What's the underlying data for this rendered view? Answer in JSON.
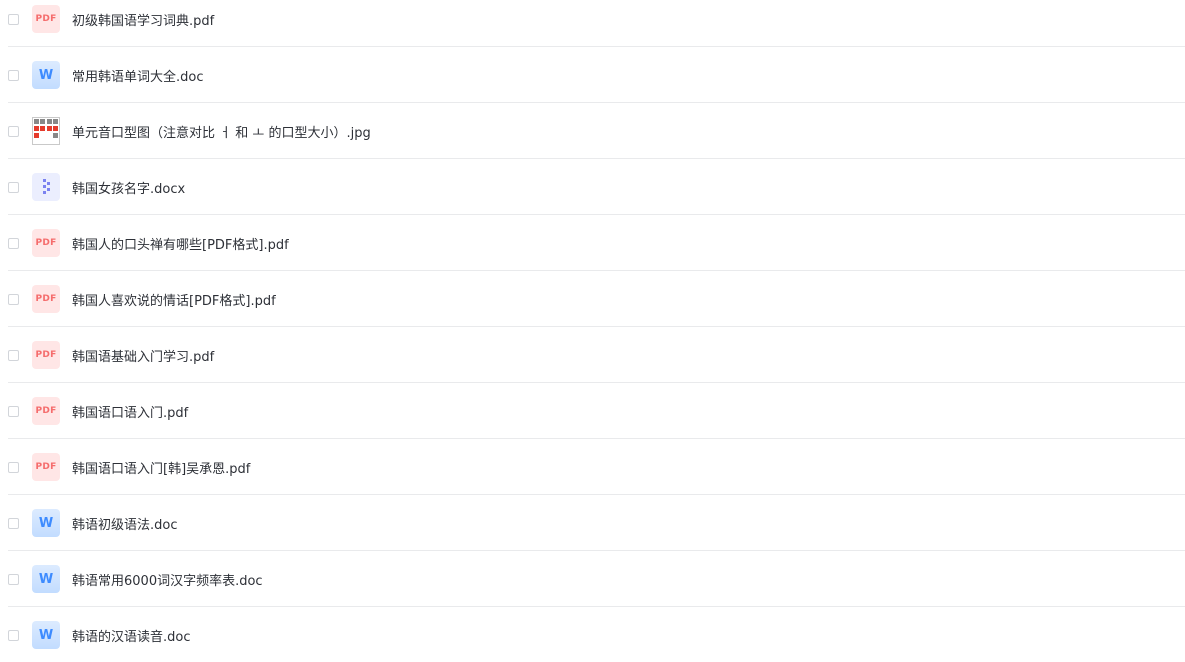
{
  "files": [
    {
      "name": "初级韩国语学习词典.pdf",
      "type": "pdf",
      "icon": "pdf-icon",
      "icon_text": "PDF"
    },
    {
      "name": "常用韩语单词大全.doc",
      "type": "doc",
      "icon": "word-icon",
      "icon_text": "W"
    },
    {
      "name": "单元音口型图（注意对比 ㅓ 和 ㅗ 的口型大小）.jpg",
      "type": "img",
      "icon": "image-thumbnail-icon",
      "icon_text": ""
    },
    {
      "name": "韩国女孩名字.docx",
      "type": "docx",
      "icon": "docx-icon",
      "icon_text": ""
    },
    {
      "name": "韩国人的口头禅有哪些[PDF格式].pdf",
      "type": "pdf",
      "icon": "pdf-icon",
      "icon_text": "PDF"
    },
    {
      "name": "韩国人喜欢说的情话[PDF格式].pdf",
      "type": "pdf",
      "icon": "pdf-icon",
      "icon_text": "PDF"
    },
    {
      "name": "韩国语基础入门学习.pdf",
      "type": "pdf",
      "icon": "pdf-icon",
      "icon_text": "PDF"
    },
    {
      "name": "韩国语口语入门.pdf",
      "type": "pdf",
      "icon": "pdf-icon",
      "icon_text": "PDF"
    },
    {
      "name": "韩国语口语入门[韩]吴承恩.pdf",
      "type": "pdf",
      "icon": "pdf-icon",
      "icon_text": "PDF"
    },
    {
      "name": "韩语初级语法.doc",
      "type": "doc",
      "icon": "word-icon",
      "icon_text": "W"
    },
    {
      "name": "韩语常用6000词汉字频率表.doc",
      "type": "doc",
      "icon": "word-icon",
      "icon_text": "W"
    },
    {
      "name": "韩语的汉语读音.doc",
      "type": "doc",
      "icon": "word-icon",
      "icon_text": "W"
    }
  ],
  "colors": {
    "pdf_accent": "#f56c6c",
    "pdf_bg": "#ffe6e6",
    "word_accent": "#3d8bff",
    "docx_accent": "#7b82f0",
    "text": "#2d3037",
    "divider": "#e9eaec"
  }
}
